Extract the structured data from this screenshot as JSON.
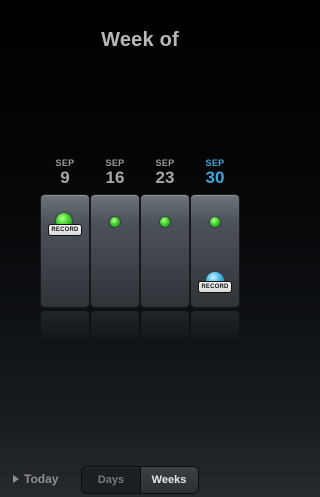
{
  "header": {
    "title": "Week of"
  },
  "weeks": [
    {
      "month": "SEP",
      "day": "9",
      "has_record_badge": true,
      "current": false
    },
    {
      "month": "SEP",
      "day": "16",
      "has_record_badge": false,
      "current": false
    },
    {
      "month": "SEP",
      "day": "23",
      "has_record_badge": false,
      "current": false
    },
    {
      "month": "SEP",
      "day": "30",
      "has_record_badge": false,
      "current": true
    }
  ],
  "badges": {
    "record_label": "RECORD"
  },
  "footer": {
    "today_label": "Today",
    "tabs": [
      {
        "label": "Days",
        "active": false
      },
      {
        "label": "Weeks",
        "active": true
      }
    ]
  },
  "colors": {
    "accent_current": "#3fa6d8",
    "dot_green": "#3fd12b",
    "dot_blue": "#3ab2e6"
  }
}
